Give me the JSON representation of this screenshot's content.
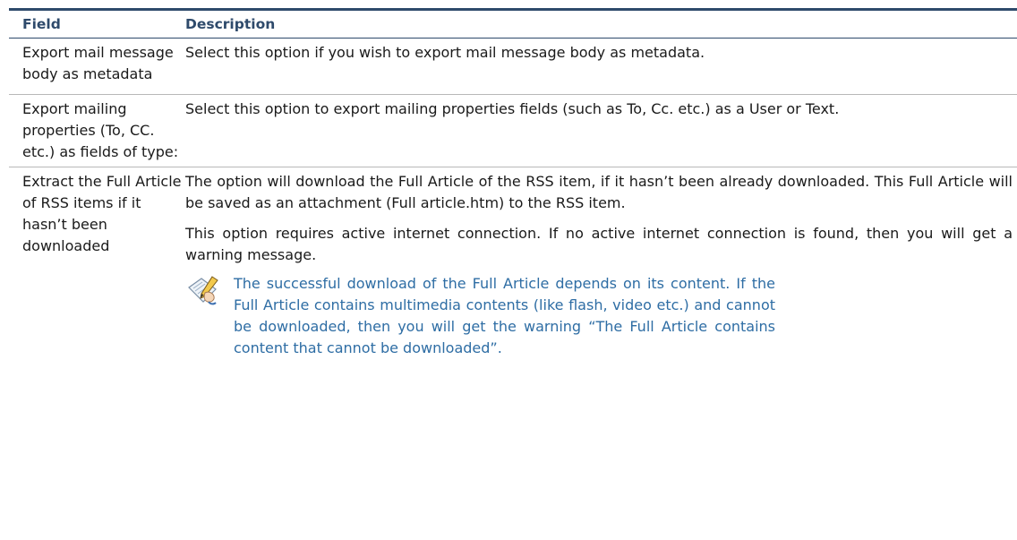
{
  "table": {
    "header": {
      "field": "Field",
      "description": "Description"
    },
    "rows": [
      {
        "field": "Export mail message body as metadata",
        "description": "Select this option if you wish to export mail message body as metadata."
      },
      {
        "field": "Export mailing properties (To, CC. etc.) as fields of type:",
        "description": "Select this option to export mailing properties fields (such as To, Cc. etc.)  as a User or Text."
      },
      {
        "field": "Extract the Full Article of RSS items if it hasn’t been downloaded",
        "description_p1": "The option will download the Full Article of the RSS item, if it hasn’t been already downloaded.  This Full Article will be saved as an attachment (Full article.htm) to the RSS item.",
        "description_p2": "This option requires active internet connection.  If no active internet connection is found, then you will get a warning message.",
        "note": "The successful download of the Full Article depends on its content. If the Full Article contains multimedia contents (like flash, video etc.) and cannot be downloaded, then you will get the warning “The Full Article contains content that cannot be downloaded”."
      }
    ]
  },
  "icons": {
    "note_icon": "note-pencil-icon"
  },
  "colors": {
    "header_text": "#2e4a6b",
    "note_text": "#2e6da4",
    "rule_top": "#2e4a6b",
    "row_divider": "#b8b8b8"
  }
}
